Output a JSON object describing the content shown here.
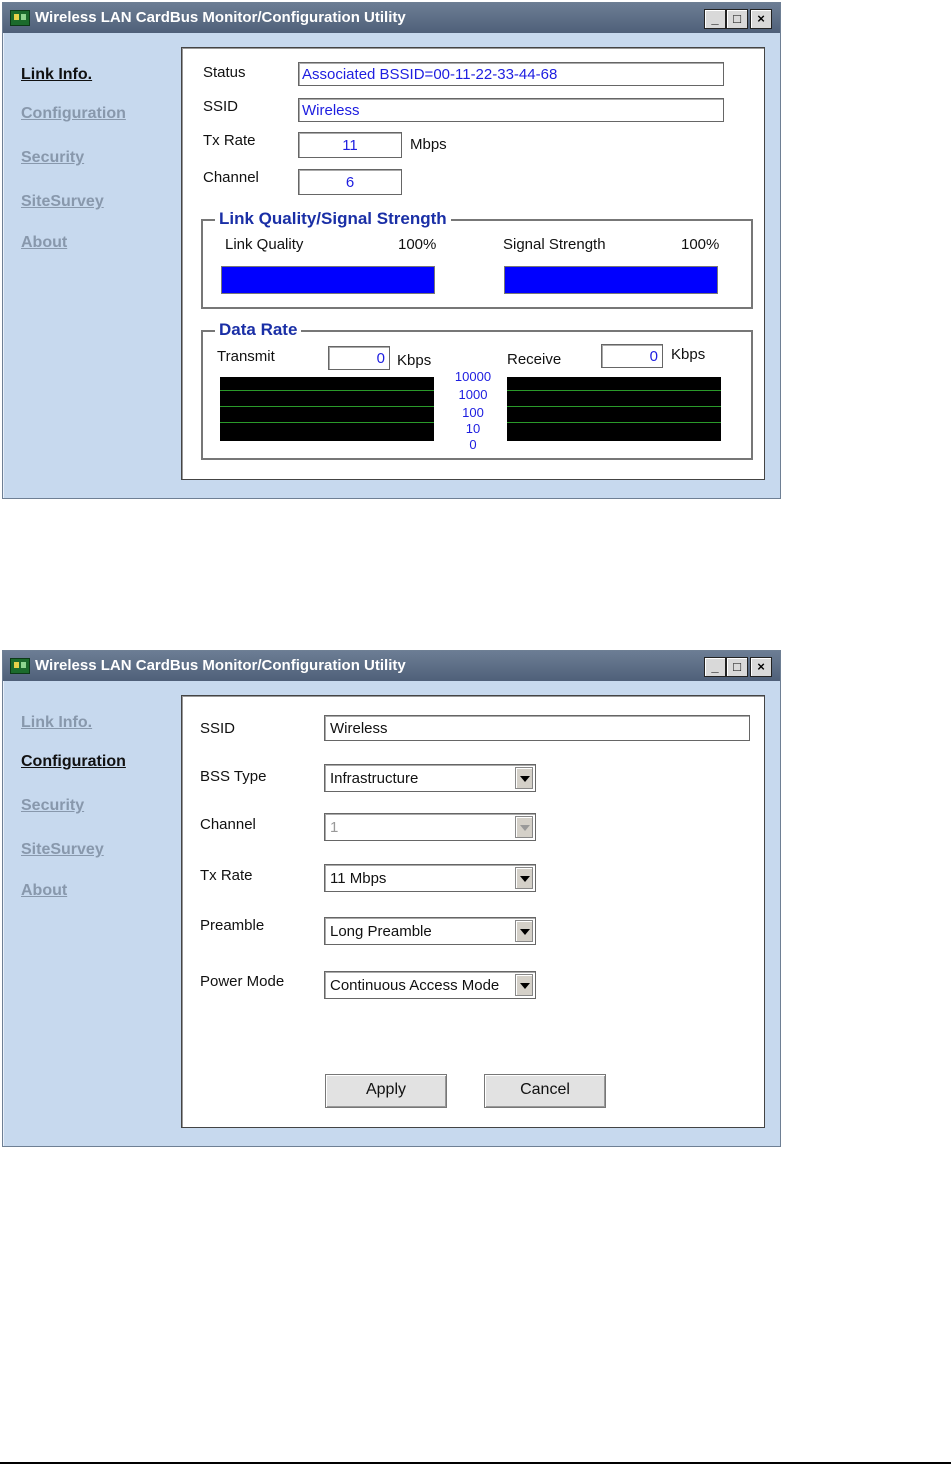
{
  "window_title": "Wireless LAN CardBus Monitor/Configuration Utility",
  "title_buttons": {
    "minimize": "_",
    "maximize": "□",
    "close": "×"
  },
  "nav": [
    "Link Info.",
    "Configuration",
    "Security",
    "SiteSurvey",
    "About"
  ],
  "screen1": {
    "active_nav": "Link Info.",
    "status_label": "Status",
    "status_value": "Associated BSSID=00-11-22-33-44-68",
    "ssid_label": "SSID",
    "ssid_value": "Wireless",
    "txrate_label": "Tx Rate",
    "txrate_value": "11",
    "txrate_unit": "Mbps",
    "channel_label": "Channel",
    "channel_value": "6",
    "link_group_title": "Link Quality/Signal Strength",
    "link_quality_label": "Link Quality",
    "link_quality_value": "100%",
    "link_quality_level": 1.0,
    "signal_strength_label": "Signal Strength",
    "signal_strength_value": "100%",
    "signal_strength_level": 1.0,
    "data_rate_title": "Data Rate",
    "transmit_label": "Transmit",
    "transmit_value": "0",
    "transmit_unit": "Kbps",
    "receive_label": "Receive",
    "receive_value": "0",
    "receive_unit": "Kbps",
    "scale": [
      "10000",
      "1000",
      "100",
      "10",
      "0"
    ],
    "bar_color": "#0000ff"
  },
  "screen2": {
    "active_nav": "Configuration",
    "ssid_label": "SSID",
    "ssid_value": "Wireless",
    "bss_type_label": "BSS Type",
    "bss_type_value": "Infrastructure",
    "channel_label": "Channel",
    "channel_value": "1",
    "txrate_label": "Tx Rate",
    "txrate_value": "11 Mbps",
    "preamble_label": "Preamble",
    "preamble_value": "Long Preamble",
    "power_mode_label": "Power Mode",
    "power_mode_value": "Continuous Access Mode",
    "apply_label": "Apply",
    "cancel_label": "Cancel"
  }
}
